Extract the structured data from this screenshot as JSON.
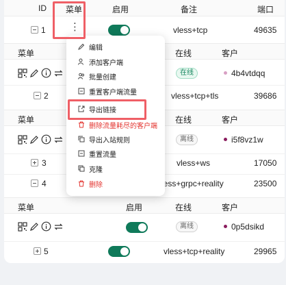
{
  "header": {
    "id": "ID",
    "menu": "菜单",
    "enable": "启用",
    "remark": "备注",
    "port": "端口"
  },
  "inbounds": [
    {
      "id": "1",
      "remark": "vless+tcp",
      "port": "49635"
    },
    {
      "id": "2",
      "remark": "vless+tcp+tls",
      "port": "39686"
    },
    {
      "id": "3",
      "remark": "vless+ws",
      "port": "17050"
    },
    {
      "id": "4",
      "remark": "vless+grpc+reality",
      "port": "23500"
    },
    {
      "id": "5",
      "remark": "vless+tcp+reality",
      "port": "29965"
    }
  ],
  "client_header": {
    "menu": "菜单",
    "enable": "启用",
    "online": "在线",
    "client": "客户"
  },
  "clients": [
    {
      "status": "在线",
      "email": "4b4vtdqq",
      "dot_color": "#d8a0c4"
    },
    {
      "status": "离线",
      "email": "i5f8vz1w",
      "dot_color": "#8a1c5e"
    },
    {
      "status": "离线",
      "email": "0p5dsikd",
      "dot_color": "#8a1c5e"
    }
  ],
  "menu": {
    "items": [
      {
        "label": "编辑",
        "icon": "edit-icon"
      },
      {
        "label": "添加客户端",
        "icon": "user-add-icon"
      },
      {
        "label": "批量创建",
        "icon": "users-add-icon"
      },
      {
        "label": "重置客户端流量",
        "icon": "reset-icon"
      },
      {
        "label": "导出链接",
        "icon": "export-icon"
      },
      {
        "label": "删除流量耗尽的客户端",
        "icon": "delete-icon"
      },
      {
        "label": "导出入站规则",
        "icon": "copy-icon"
      },
      {
        "label": "重置流量",
        "icon": "reset-icon"
      },
      {
        "label": "克隆",
        "icon": "clone-icon"
      },
      {
        "label": "删除",
        "icon": "delete-icon"
      }
    ]
  },
  "colors": {
    "accent": "#0f7a5a",
    "danger": "#e3342f",
    "highlight": "#ef5f66"
  }
}
